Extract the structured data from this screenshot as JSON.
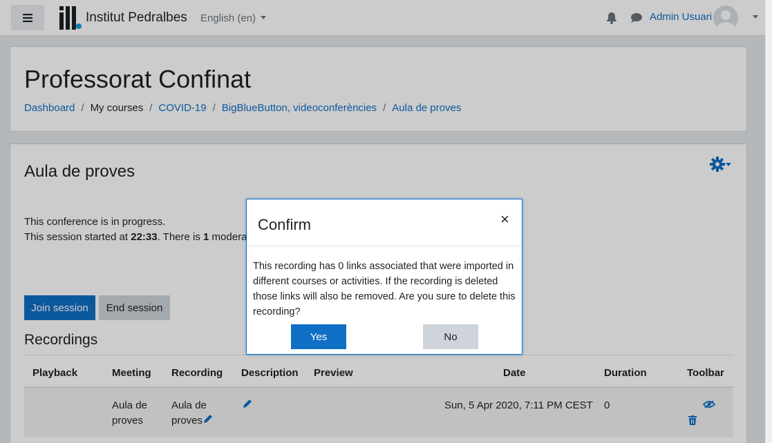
{
  "navbar": {
    "site_name": "Institut Pedralbes",
    "language": "English (en)",
    "user_name": "Admin Usuari",
    "icons": [
      "menu-icon",
      "bell-icon",
      "chat-icon",
      "avatar-icon"
    ]
  },
  "header": {
    "title": "Professorat Confinat",
    "breadcrumb": [
      "Dashboard",
      "My courses",
      "COVID-19",
      "BigBlueButton, videoconferències",
      "Aula de proves"
    ]
  },
  "activity": {
    "title": "Aula de proves",
    "status_line1": "This conference is in progress.",
    "status_line2_prefix": "This session started at ",
    "start_time": "22:33",
    "status_line2_mid": ". There is ",
    "moderator_count": "1",
    "status_line2_suffix": " moderat",
    "join_label": "Join session",
    "end_label": "End session"
  },
  "recordings": {
    "title": "Recordings",
    "columns": [
      "Playback",
      "Meeting",
      "Recording",
      "Description",
      "Preview",
      "Date",
      "Duration",
      "Toolbar"
    ],
    "rows": [
      {
        "playback": "",
        "meeting": "Aula de proves",
        "recording": "Aula de proves",
        "description": "",
        "preview": "",
        "date": "Sun, 5 Apr 2020, 7:11 PM CEST",
        "duration": "0"
      }
    ]
  },
  "modal": {
    "title": "Confirm",
    "close": "×",
    "body": "This recording has 0 links associated that were imported in different courses or activities. If the recording is deleted those links will also be removed. Are you sure to delete this recording?",
    "yes_label": "Yes",
    "no_label": "No"
  },
  "colors": {
    "accent": "#0f6fc5",
    "secondary": "#ced4da"
  }
}
